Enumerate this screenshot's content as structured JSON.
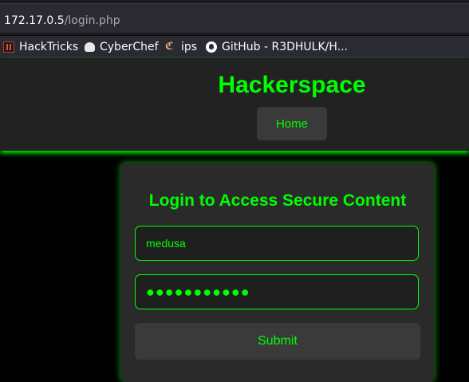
{
  "browser": {
    "url_host": "172.17.0.5",
    "url_path": "/login.php",
    "bookmarks": [
      {
        "label": "HackTricks",
        "icon": "hacktricks-icon"
      },
      {
        "label": "CyberChef",
        "icon": "cyberchef-icon"
      },
      {
        "label": "ips",
        "icon": "ips-icon"
      },
      {
        "label": "GitHub - R3DHULK/H...",
        "icon": "github-icon"
      }
    ]
  },
  "header": {
    "title": "Hackerspace",
    "nav_home": "Home"
  },
  "login": {
    "heading": "Login to Access Secure Content",
    "username_value": "medusa",
    "password_mask": "●●●●●●●●●●●",
    "submit_label": "Submit"
  },
  "colors": {
    "accent": "#00ff00",
    "page_bg": "#000000",
    "card_bg": "#2a2a2a",
    "header_bg": "#222222"
  }
}
